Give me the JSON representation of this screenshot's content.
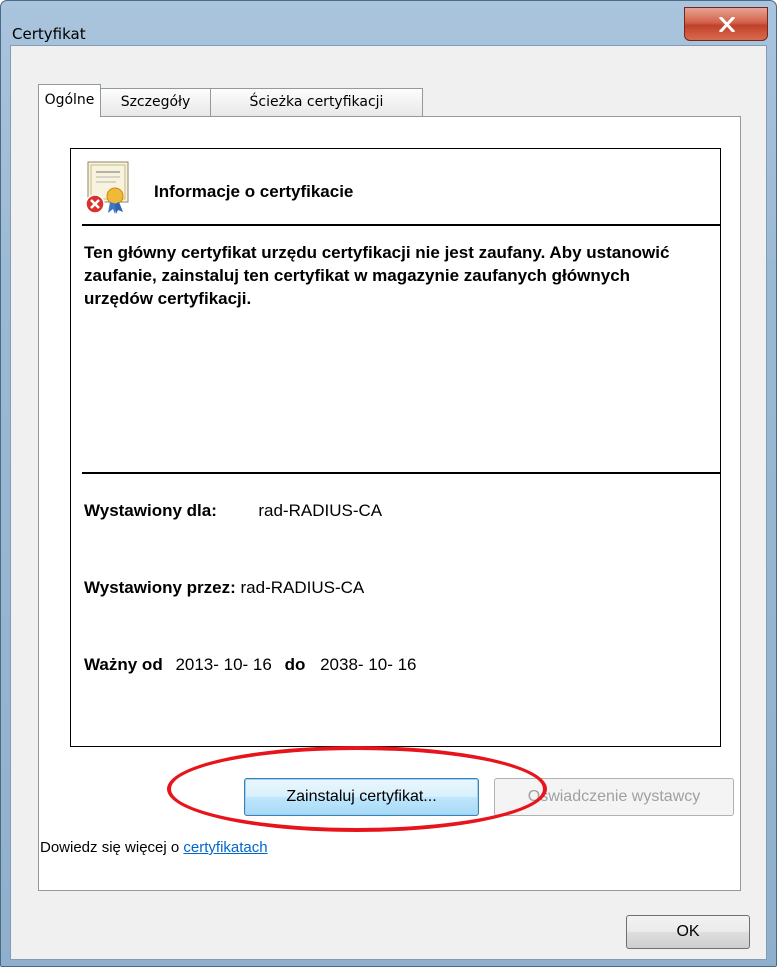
{
  "window": {
    "title": "Certyfikat",
    "close_icon": "close-icon"
  },
  "tabs": [
    {
      "label": "Ogólne",
      "active": true
    },
    {
      "label": "Szczegóły",
      "active": false
    },
    {
      "label": "Ścieżka certyfikacji",
      "active": false
    }
  ],
  "info": {
    "icon": "certificate-error-icon",
    "heading": "Informacje o certyfikacie",
    "description": "Ten główny certyfikat urzędu certyfikacji nie jest zaufany. Aby ustanowić zaufanie, zainstaluj ten certyfikat w magazynie zaufanych głównych urzędów certyfikacji.",
    "issued_to_label": "Wystawiony dla:",
    "issued_to_value": "rad-RADIUS-CA",
    "issued_by_label": "Wystawiony przez:",
    "issued_by_value": "rad-RADIUS-CA",
    "valid_from_label": "Ważny od",
    "valid_from_value": "2013- 10- 16",
    "valid_to_label": "do",
    "valid_to_value": "2038- 10- 16"
  },
  "buttons": {
    "install": "Zainstaluj certyfikat...",
    "issuer_statement": "Oświadczenie wystawcy",
    "ok": "OK"
  },
  "learn_more": {
    "prefix": "Dowiedz się więcej o ",
    "link": "certyfikatach"
  },
  "annotation": {
    "color": "#e8141c"
  }
}
